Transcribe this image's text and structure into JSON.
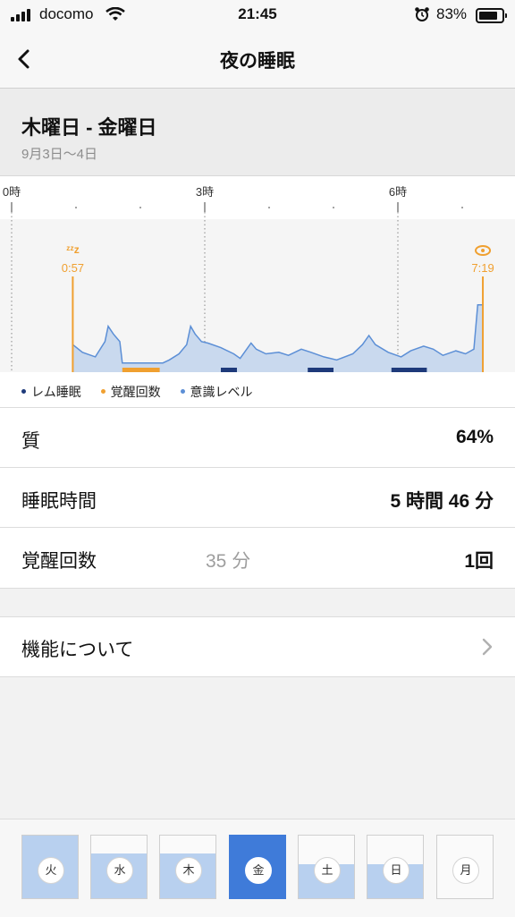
{
  "status_bar": {
    "carrier": "docomo",
    "time": "21:45",
    "battery_percent": "83%",
    "battery_level": 0.83
  },
  "nav": {
    "title": "夜の睡眠",
    "back_icon": "chevron-left-icon"
  },
  "header": {
    "date_range": "木曜日 - 金曜日",
    "sub_date": "9月3日〜4日"
  },
  "chart_data": {
    "type": "area",
    "x_ticks": [
      "0時",
      "3時",
      "6時"
    ],
    "x_tick_hours": [
      0,
      3,
      6
    ],
    "x_range_hours": [
      0,
      7.5
    ],
    "sleep_start": {
      "label": "0:57",
      "hour": 0.95
    },
    "wake": {
      "label": "7:19",
      "hour": 7.32
    },
    "consciousness_series": [
      [
        0.95,
        0.18
      ],
      [
        1.1,
        0.13
      ],
      [
        1.3,
        0.1
      ],
      [
        1.45,
        0.2
      ],
      [
        1.5,
        0.3
      ],
      [
        1.58,
        0.25
      ],
      [
        1.68,
        0.2
      ],
      [
        1.72,
        0.06
      ],
      [
        2.35,
        0.06
      ],
      [
        2.45,
        0.08
      ],
      [
        2.6,
        0.12
      ],
      [
        2.72,
        0.18
      ],
      [
        2.78,
        0.3
      ],
      [
        2.85,
        0.25
      ],
      [
        2.95,
        0.2
      ],
      [
        3.05,
        0.19
      ],
      [
        3.25,
        0.16
      ],
      [
        3.45,
        0.12
      ],
      [
        3.55,
        0.09
      ],
      [
        3.72,
        0.19
      ],
      [
        3.8,
        0.15
      ],
      [
        3.95,
        0.12
      ],
      [
        4.15,
        0.13
      ],
      [
        4.3,
        0.11
      ],
      [
        4.5,
        0.15
      ],
      [
        4.65,
        0.13
      ],
      [
        4.85,
        0.1
      ],
      [
        5.05,
        0.08
      ],
      [
        5.3,
        0.12
      ],
      [
        5.45,
        0.18
      ],
      [
        5.55,
        0.24
      ],
      [
        5.65,
        0.18
      ],
      [
        5.85,
        0.13
      ],
      [
        6.05,
        0.1
      ],
      [
        6.2,
        0.14
      ],
      [
        6.4,
        0.17
      ],
      [
        6.55,
        0.15
      ],
      [
        6.7,
        0.11
      ],
      [
        6.9,
        0.14
      ],
      [
        7.05,
        0.12
      ],
      [
        7.18,
        0.15
      ],
      [
        7.24,
        0.44
      ],
      [
        7.32,
        0.44
      ]
    ],
    "awake_segments": [
      [
        1.72,
        2.3
      ]
    ],
    "rem_segments": [
      [
        3.25,
        3.5
      ],
      [
        4.6,
        5.0
      ],
      [
        5.9,
        6.45
      ]
    ],
    "legend": [
      {
        "label": "レム睡眠",
        "color": "#1e3a7a"
      },
      {
        "label": "覚醒回数",
        "color": "#f0a030"
      },
      {
        "label": "意識レベル",
        "color": "#5c8fd6"
      }
    ]
  },
  "stats": {
    "quality": {
      "label": "質",
      "value": "64%"
    },
    "sleep_time": {
      "label": "睡眠時間",
      "value": "5 時間 46 分"
    },
    "awake": {
      "label": "覚醒回数",
      "mid": "35 分",
      "value": "1回"
    }
  },
  "feature": {
    "label": "機能について"
  },
  "days": [
    {
      "label": "火",
      "level": 1.0,
      "selected": false
    },
    {
      "label": "水",
      "level": 0.72,
      "selected": false
    },
    {
      "label": "木",
      "level": 0.72,
      "selected": false
    },
    {
      "label": "金",
      "level": 0.64,
      "selected": true
    },
    {
      "label": "土",
      "level": 0.55,
      "selected": false
    },
    {
      "label": "日",
      "level": 0.55,
      "selected": false
    },
    {
      "label": "月",
      "level": 0,
      "selected": false
    }
  ],
  "colors": {
    "accent": "#3f7bd9",
    "awake_orange": "#f0a030",
    "rem_navy": "#1e3a7a",
    "area_fill": "#c9d9ee",
    "area_line": "#5c8fd6"
  }
}
